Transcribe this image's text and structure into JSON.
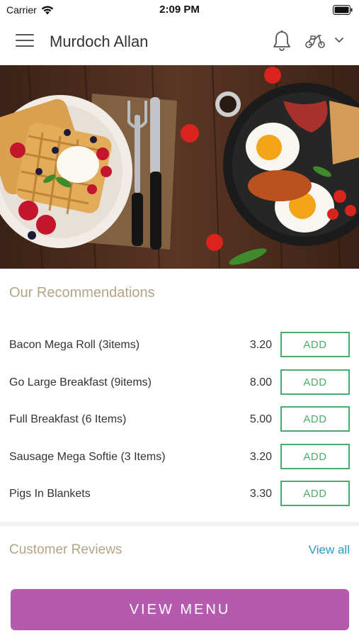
{
  "status_bar": {
    "carrier": "Carrier",
    "time": "2:09 PM"
  },
  "header": {
    "title": "Murdoch Allan"
  },
  "recommendations": {
    "title": "Our Recommendations",
    "items": [
      {
        "name": "Bacon Mega Roll (3items)",
        "price": "3.20",
        "button": "ADD"
      },
      {
        "name": "Go Large Breakfast (9items)",
        "price": "8.00",
        "button": "ADD"
      },
      {
        "name": "Full Breakfast (6 Items)",
        "price": "5.00",
        "button": "ADD"
      },
      {
        "name": "Sausage Mega Softie (3 Items)",
        "price": "3.20",
        "button": "ADD"
      },
      {
        "name": "Pigs In Blankets",
        "price": "3.30",
        "button": "ADD"
      }
    ]
  },
  "reviews": {
    "title": "Customer Reviews",
    "view_all": "View all"
  },
  "footer": {
    "view_menu": "VIEW MENU"
  },
  "colors": {
    "accent_green": "#4caa6b",
    "section_title": "#b3a486",
    "link_blue": "#2a9bc9",
    "menu_button": "#b55aae"
  },
  "icons": [
    "menu-icon",
    "bell-icon",
    "scooter-icon",
    "chevron-down-icon",
    "wifi-icon",
    "battery-icon"
  ]
}
